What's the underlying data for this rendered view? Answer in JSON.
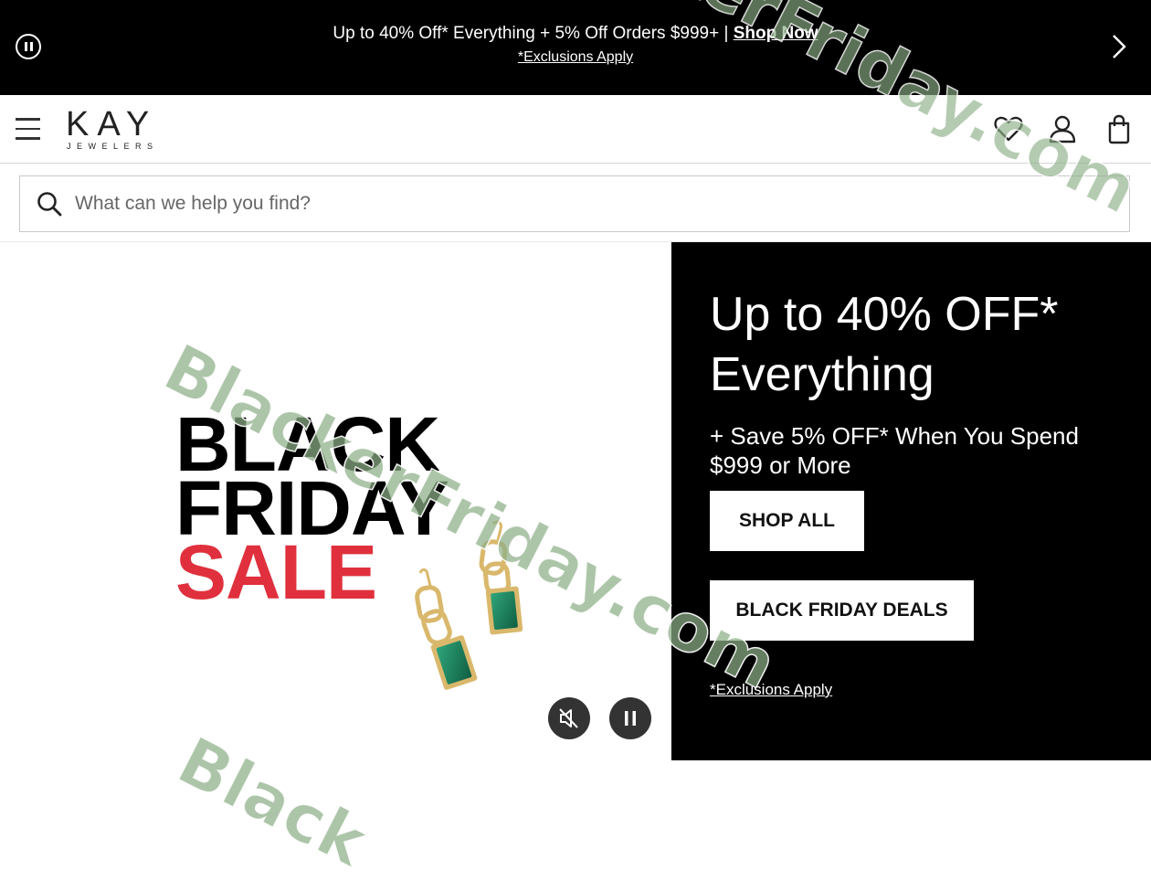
{
  "promo": {
    "text": "Up to 40% Off* Everything + 5% Off Orders $999+ | ",
    "link": "Shop Now",
    "exclusions": "*Exclusions Apply"
  },
  "header": {
    "logo_main": "KAY",
    "logo_sub": "JEWELERS"
  },
  "search": {
    "placeholder": "What can we help you find?"
  },
  "hero": {
    "bf_line1": "BLACK",
    "bf_line2": "FRIDAY",
    "bf_line3": "SALE",
    "headline": "Up to 40% OFF* Everything",
    "subtext": "+ Save 5% OFF* When You Spend $999 or More",
    "shop_all": "SHOP ALL",
    "deals": "BLACK FRIDAY DEALS",
    "exclusions": "*Exclusions Apply"
  },
  "watermark": {
    "text1": "BlackerFriday.com",
    "text2": "BlackerFriday.com",
    "text3": "Black"
  },
  "colors": {
    "sale_red": "#e0303d",
    "promo_bg": "#000000",
    "emerald": "#1d8a62",
    "gold": "#d9b86c"
  }
}
